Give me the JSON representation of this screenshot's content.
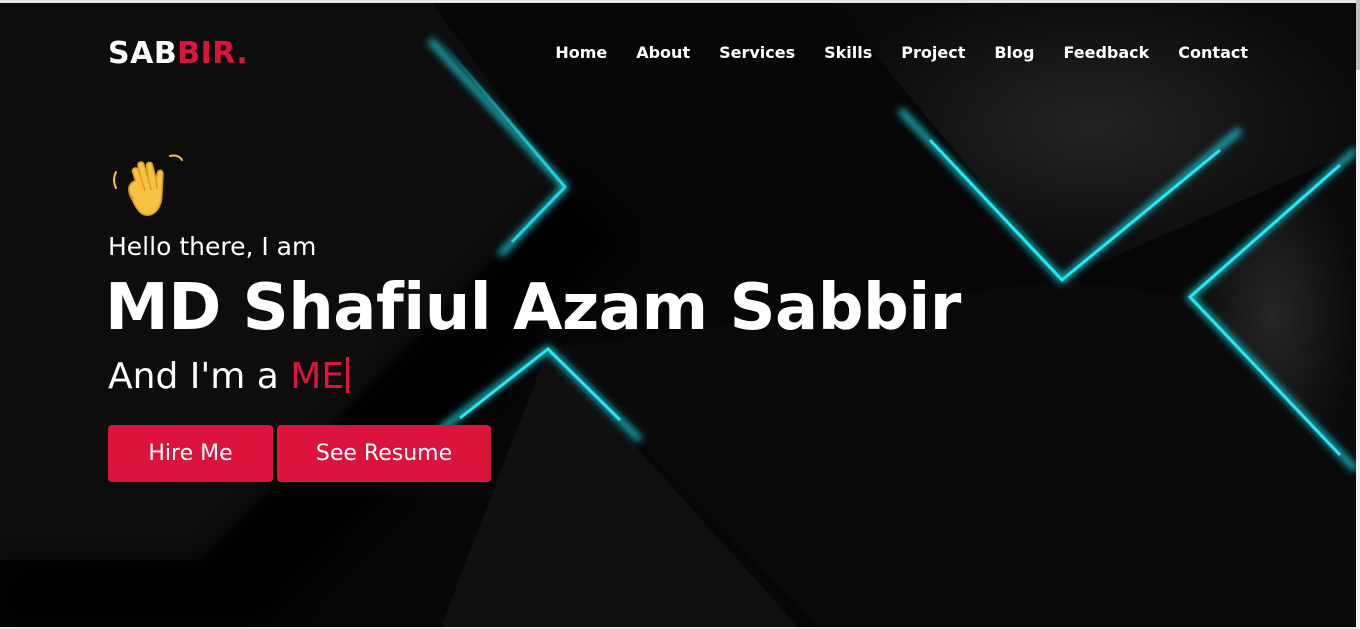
{
  "brand": {
    "logo_white": "SAB",
    "logo_red": "BIR.",
    "accent_color": "#dc143c",
    "glow_color": "#1fe3f0"
  },
  "nav": {
    "items": [
      {
        "label": "Home"
      },
      {
        "label": "About"
      },
      {
        "label": "Services"
      },
      {
        "label": "Skills"
      },
      {
        "label": "Project"
      },
      {
        "label": "Blog"
      },
      {
        "label": "Feedback"
      },
      {
        "label": "Contact"
      }
    ]
  },
  "hero": {
    "wave_icon": "waving-hand-icon",
    "greeting": "Hello there, I am",
    "name": "MD Shafiul Azam Sabbir",
    "role_prefix": "And I'm a ",
    "role_typed": "ME",
    "hire_label": "Hire Me",
    "resume_label": "See Resume"
  }
}
